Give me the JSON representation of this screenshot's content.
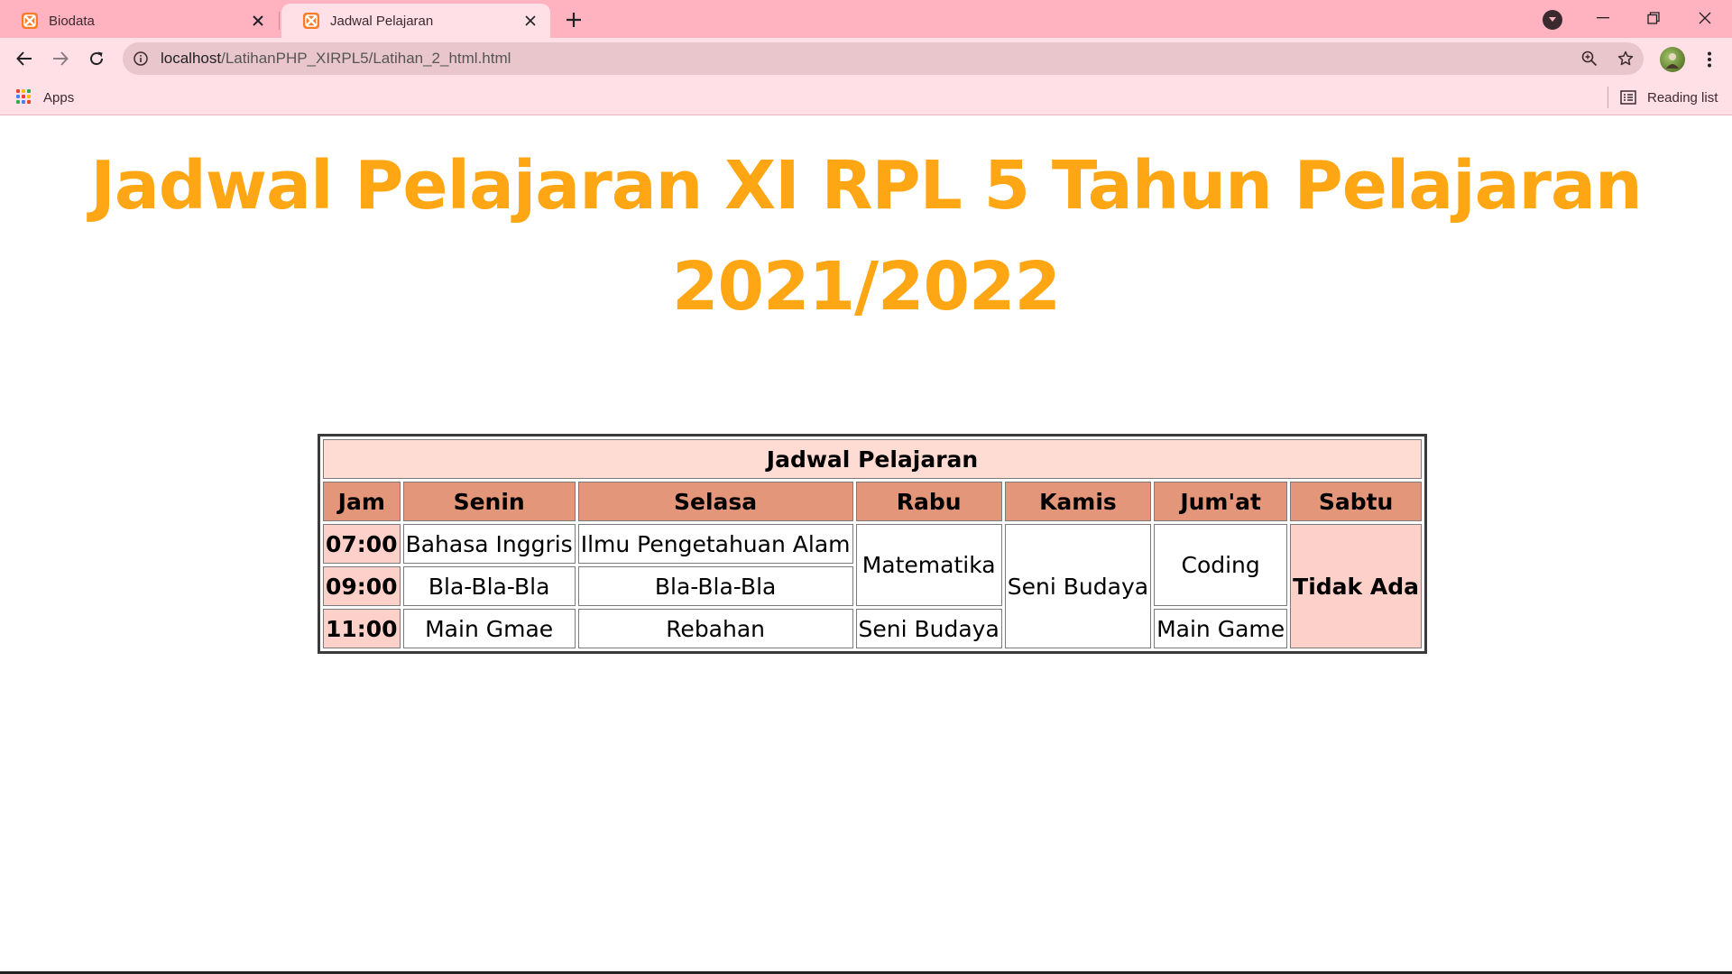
{
  "browser": {
    "tabs": [
      {
        "title": "Biodata",
        "active": false
      },
      {
        "title": "Jadwal Pelajaran",
        "active": true
      }
    ],
    "url": {
      "host": "localhost",
      "path": "/LatihanPHP_XIRPL5/Latihan_2_html.html"
    },
    "bookmarks": {
      "apps_label": "Apps",
      "reading_list_label": "Reading list"
    },
    "colors": {
      "tabstrip": "#ffb3c1",
      "toolbar": "#ffe0e6",
      "omnibox": "#e9c6cc"
    }
  },
  "page": {
    "title": "Jadwal Pelajaran XI RPL 5 Tahun Pelajaran 2021/2022",
    "title_color": "#fea613",
    "table": {
      "caption": "Jadwal Pelajaran",
      "headers": [
        "Jam",
        "Senin",
        "Selasa",
        "Rabu",
        "Kamis",
        "Jum'at",
        "Sabtu"
      ],
      "rows": [
        {
          "jam": "07:00",
          "senin": "Bahasa Inggris",
          "selasa": "Ilmu Pengetahuan Alam",
          "rabu": "Matematika",
          "kamis": "Seni Budaya",
          "jumat": "Coding",
          "sabtu": "Tidak Ada"
        },
        {
          "jam": "09:00",
          "senin": "Bla-Bla-Bla",
          "selasa": "Bla-Bla-Bla"
        },
        {
          "jam": "11:00",
          "senin": "Main Gmae",
          "selasa": "Rebahan",
          "rabu": "Seni Budaya",
          "jumat": "Main Game"
        }
      ],
      "colors": {
        "caption_bg": "#ffdcd3",
        "header_bg": "#e4967a",
        "jam_bg": "#fdd1ca",
        "sabtu_bg": "#fdd1ca"
      }
    }
  }
}
